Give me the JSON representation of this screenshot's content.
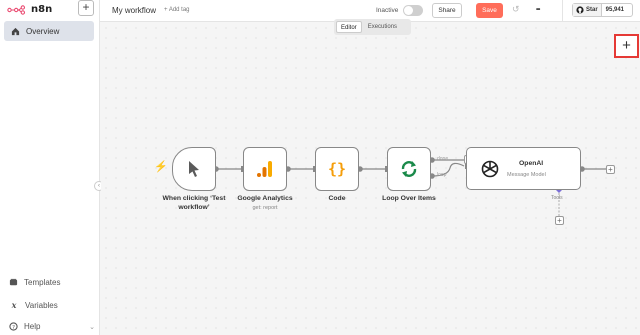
{
  "sidebar": {
    "logo_text": "n8n",
    "new_button": "+",
    "overview_label": "Overview",
    "templates_label": "Templates",
    "variables_label": "Variables",
    "help_label": "Help",
    "collapse_glyph": "‹"
  },
  "header": {
    "workflow_name": "My workflow",
    "add_tag": "+ Add tag",
    "status_label": "Inactive",
    "share_label": "Share",
    "save_label": "Save",
    "undo_glyph": "↺",
    "more_glyph": "•••"
  },
  "github": {
    "star_label": "Star",
    "star_count": "95,941"
  },
  "tabs": [
    {
      "label": "Editor",
      "active": true
    },
    {
      "label": "Executions",
      "active": false
    }
  ],
  "canvas": {
    "add_node_button": "+",
    "nodes": [
      {
        "label": "When clicking ‘Test workflow’",
        "subtitle": "",
        "icon": "cursor-icon"
      },
      {
        "label": "Google Analytics",
        "subtitle": "get: report",
        "icon": "google-analytics-icon"
      },
      {
        "label": "Code",
        "subtitle": "",
        "icon": "code-braces-icon"
      },
      {
        "label": "Loop Over Items",
        "subtitle": "",
        "icon": "loop-arrows-icon"
      }
    ],
    "ai_node": {
      "title": "OpenAI",
      "subtitle": "Message Model",
      "icon": "openai-icon"
    },
    "loop_outputs": {
      "done": "done",
      "loop": "loop"
    },
    "tools_label": "Tools"
  },
  "colors": {
    "accent": "#ff6d5a",
    "highlight_border": "#e53935",
    "code_orange": "#f59e0b",
    "loop_green": "#1a8a4a",
    "analytics_orange": "#f9ab00",
    "tool_connector": "#7b6fd6"
  }
}
